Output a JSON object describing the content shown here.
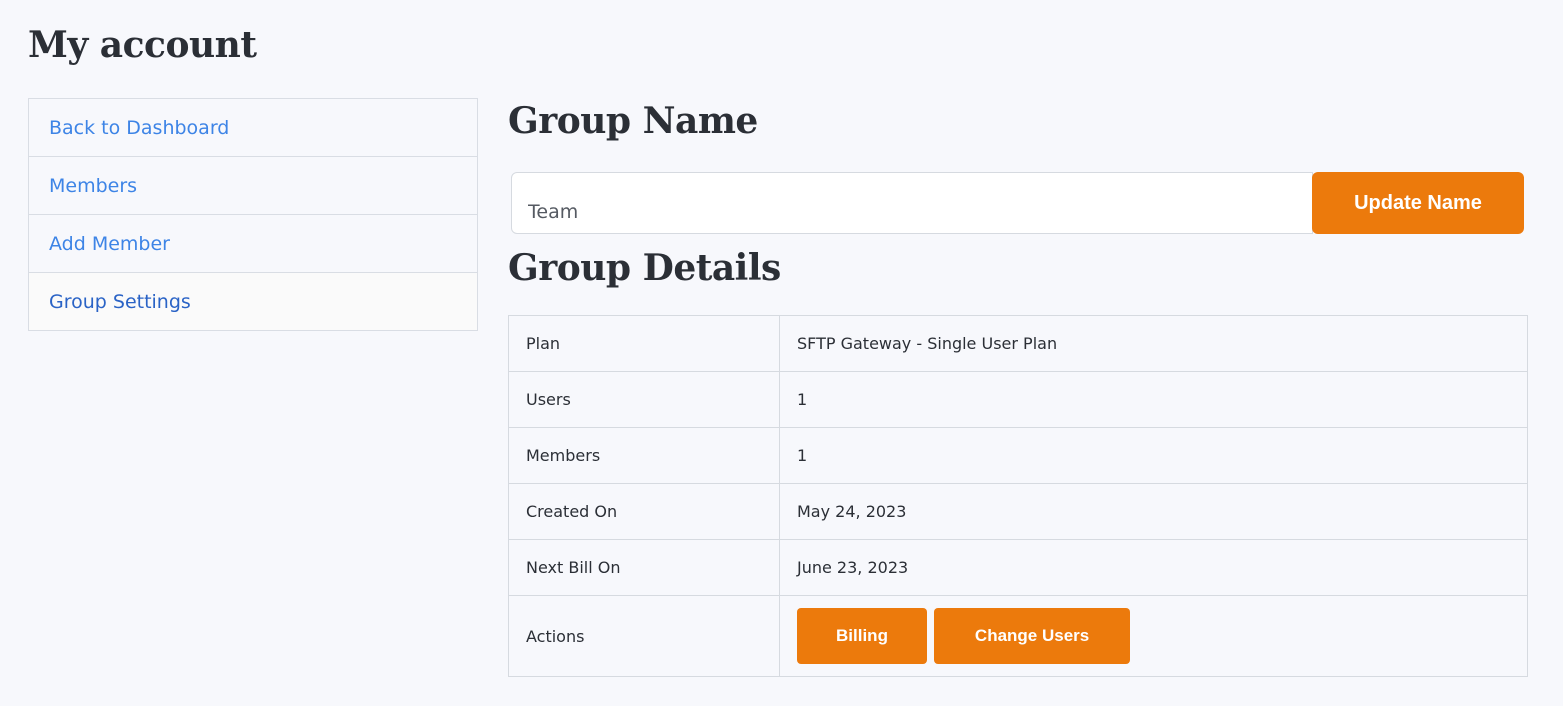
{
  "page": {
    "title": "My account"
  },
  "sidebar": {
    "items": [
      {
        "label": "Back to Dashboard"
      },
      {
        "label": "Members"
      },
      {
        "label": "Add Member"
      },
      {
        "label": "Group Settings"
      }
    ],
    "active": "Group Settings"
  },
  "group_name": {
    "heading": "Group Name",
    "input_value": "Team",
    "button_label": "Update Name"
  },
  "group_details": {
    "heading": "Group Details",
    "rows": [
      {
        "label": "Plan",
        "value": "SFTP Gateway - Single User Plan"
      },
      {
        "label": "Users",
        "value": "1"
      },
      {
        "label": "Members",
        "value": "1"
      },
      {
        "label": "Created On",
        "value": "May 24, 2023"
      },
      {
        "label": "Next Bill On",
        "value": "June 23, 2023"
      },
      {
        "label": "Actions"
      }
    ],
    "actions": {
      "billing_label": "Billing",
      "change_users_label": "Change Users"
    }
  },
  "colors": {
    "accent": "#ec7a0c",
    "link": "#3d84e6",
    "active_link": "#2a63c6",
    "background": "#f7f8fc"
  }
}
